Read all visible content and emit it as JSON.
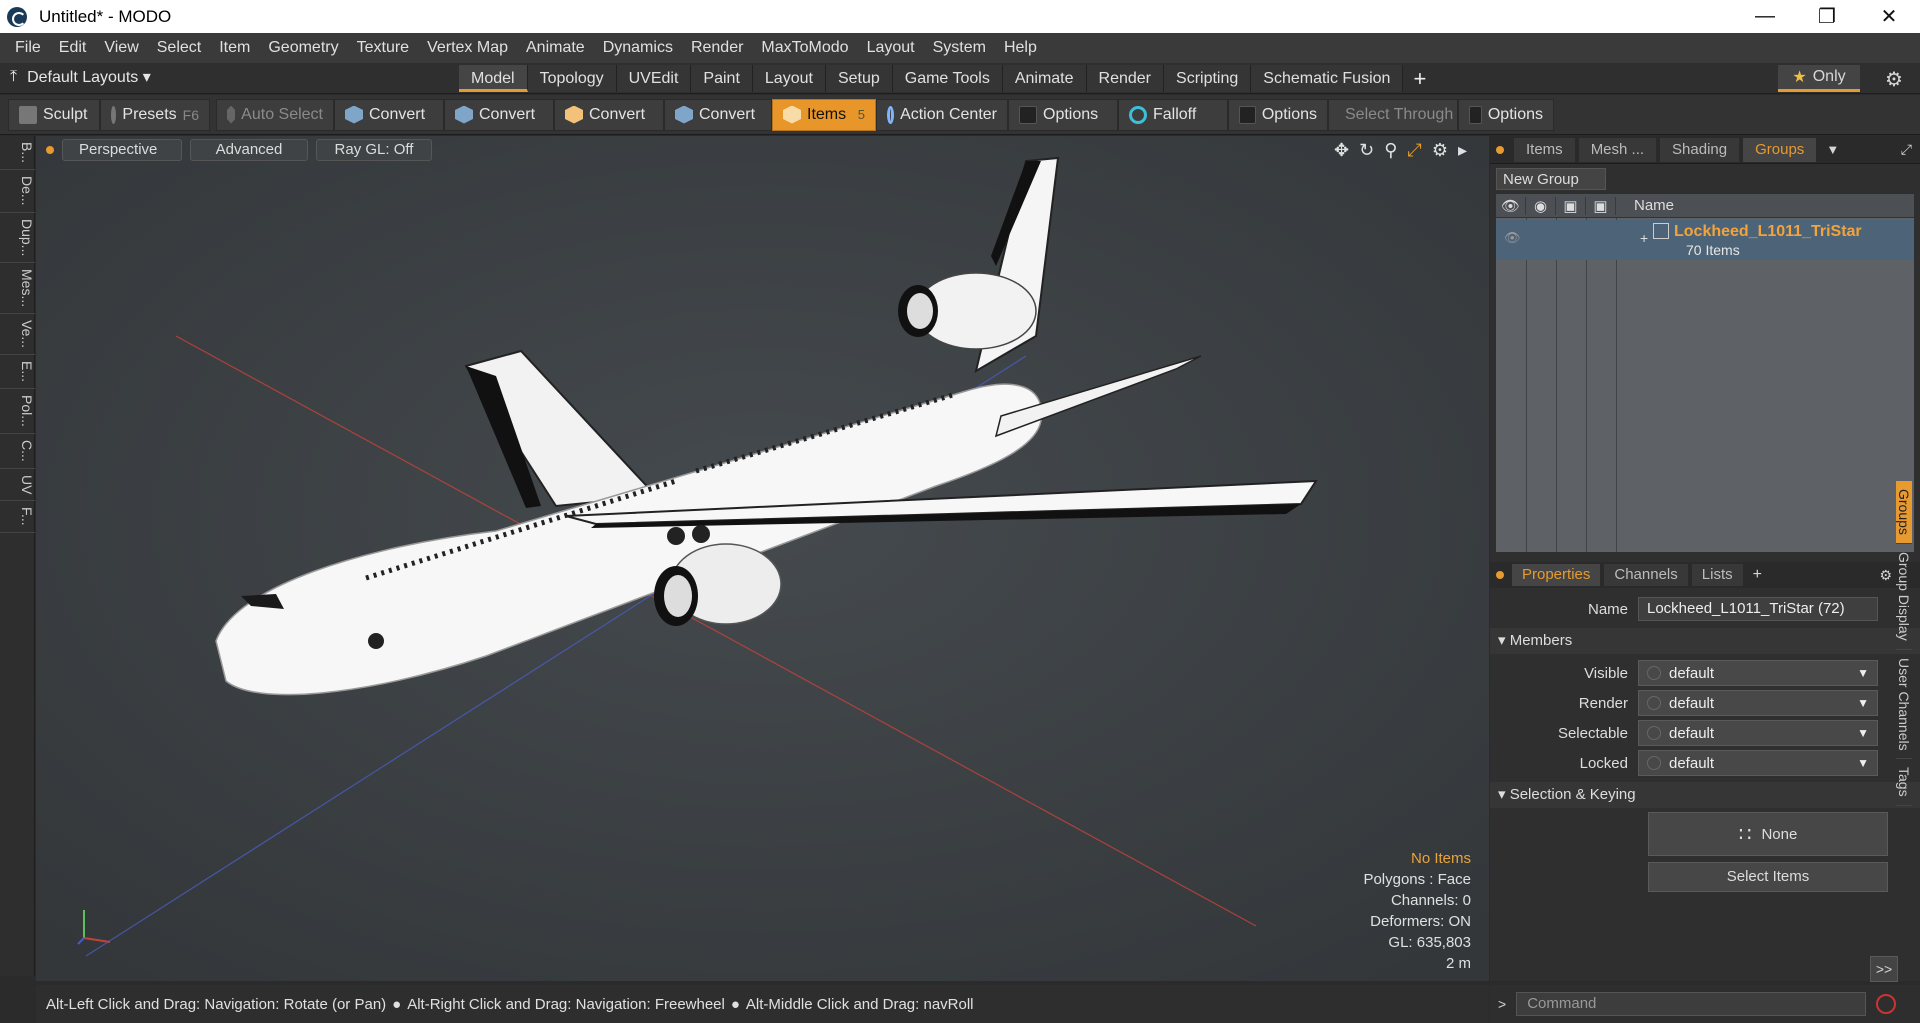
{
  "app": {
    "title": "Untitled* - MODO"
  },
  "menu": [
    "File",
    "Edit",
    "View",
    "Select",
    "Item",
    "Geometry",
    "Texture",
    "Vertex Map",
    "Animate",
    "Dynamics",
    "Render",
    "MaxToModo",
    "Layout",
    "System",
    "Help"
  ],
  "layouts": {
    "label": "Default Layouts"
  },
  "tabs": [
    "Model",
    "Topology",
    "UVEdit",
    "Paint",
    "Layout",
    "Setup",
    "Game Tools",
    "Animate",
    "Render",
    "Scripting",
    "Schematic Fusion"
  ],
  "only_label": "Only",
  "toolbar": {
    "sculpt": "Sculpt",
    "presets": "Presets",
    "presets_key": "F6",
    "auto_select": "Auto Select",
    "convert1": "Convert",
    "convert2": "Convert",
    "convert3": "Convert",
    "convert4": "Convert",
    "items": "Items",
    "items_count": "5",
    "action_center": "Action Center",
    "options1": "Options",
    "falloff": "Falloff",
    "options2": "Options",
    "select_through": "Select Through",
    "options3": "Options"
  },
  "left_tabs": [
    "B...",
    "De...",
    "Dup...",
    "Mes...",
    "Ve...",
    "E...",
    "Pol...",
    "C...",
    "UV",
    "F..."
  ],
  "viewport": {
    "perspective": "Perspective",
    "advanced": "Advanced",
    "raygl": "Ray GL: Off",
    "info": {
      "no_items": "No Items",
      "polygons": "Polygons : Face",
      "channels": "Channels: 0",
      "deformers": "Deformers: ON",
      "gl": "GL: 635,803",
      "scale": "2 m"
    }
  },
  "groups_panel": {
    "tabs": [
      "Items",
      "Mesh ...",
      "Shading",
      "Groups"
    ],
    "new_group": "New Group",
    "name_header": "Name",
    "group_name": "Lockheed_L1011_TriStar",
    "group_count": "70 Items"
  },
  "properties": {
    "tabs": [
      "Properties",
      "Channels",
      "Lists"
    ],
    "name_label": "Name",
    "name_value": "Lockheed_L1011_TriStar (72)",
    "members": "Members",
    "rows": [
      {
        "label": "Visible",
        "value": "default"
      },
      {
        "label": "Render",
        "value": "default"
      },
      {
        "label": "Selectable",
        "value": "default"
      },
      {
        "label": "Locked",
        "value": "default"
      }
    ],
    "selection_keying": "Selection & Keying",
    "none_label": "None",
    "select_items": "Select Items",
    "more": ">>",
    "side_tabs": [
      "Groups",
      "Group Display",
      "User Channels",
      "Tags"
    ]
  },
  "status": {
    "hint1": "Alt-Left Click and Drag: Navigation: Rotate (or Pan)",
    "hint2": "Alt-Right Click and Drag: Navigation: Freewheel",
    "hint3": "Alt-Middle Click and Drag: navRoll"
  },
  "command": {
    "placeholder": "Command"
  }
}
